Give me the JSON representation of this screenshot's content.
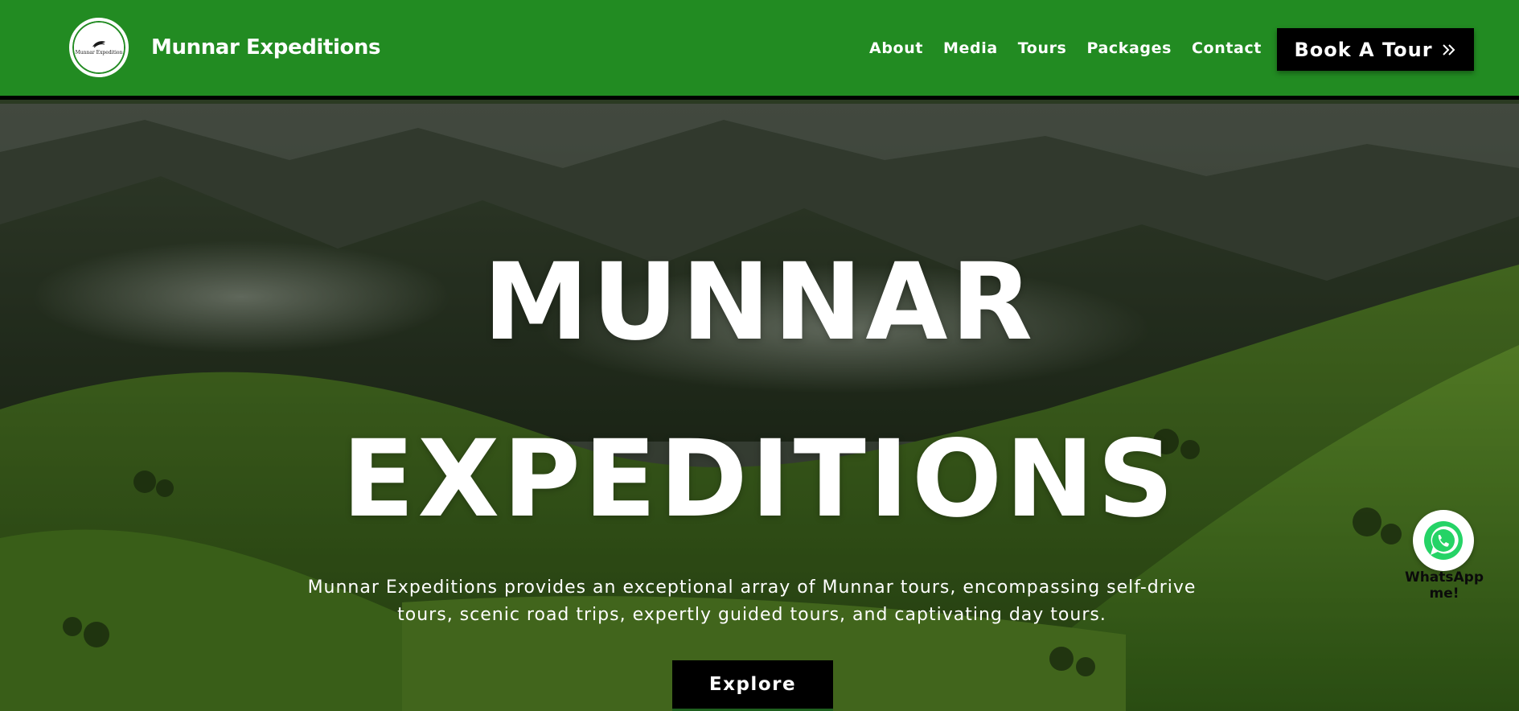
{
  "header": {
    "logo_text": "Munnar Expedition",
    "brand_name": "Munnar Expeditions",
    "nav": [
      {
        "label": "About"
      },
      {
        "label": "Media"
      },
      {
        "label": "Tours"
      },
      {
        "label": "Packages"
      },
      {
        "label": "Contact"
      }
    ],
    "cta_label": "Book A Tour",
    "cta_icon": "double-chevron-right-icon",
    "background_color": "#228b22"
  },
  "hero": {
    "title_line1": "MUNNAR",
    "title_line2": "EXPEDITIONS",
    "description": "Munnar Expeditions provides an exceptional array of Munnar tours, encompassing self-drive tours, scenic road trips, expertly guided tours, and captivating day tours.",
    "button_label": "Explore"
  },
  "whatsapp": {
    "icon": "whatsapp-icon",
    "label": "WhatsApp me!",
    "color": "#25d366"
  }
}
